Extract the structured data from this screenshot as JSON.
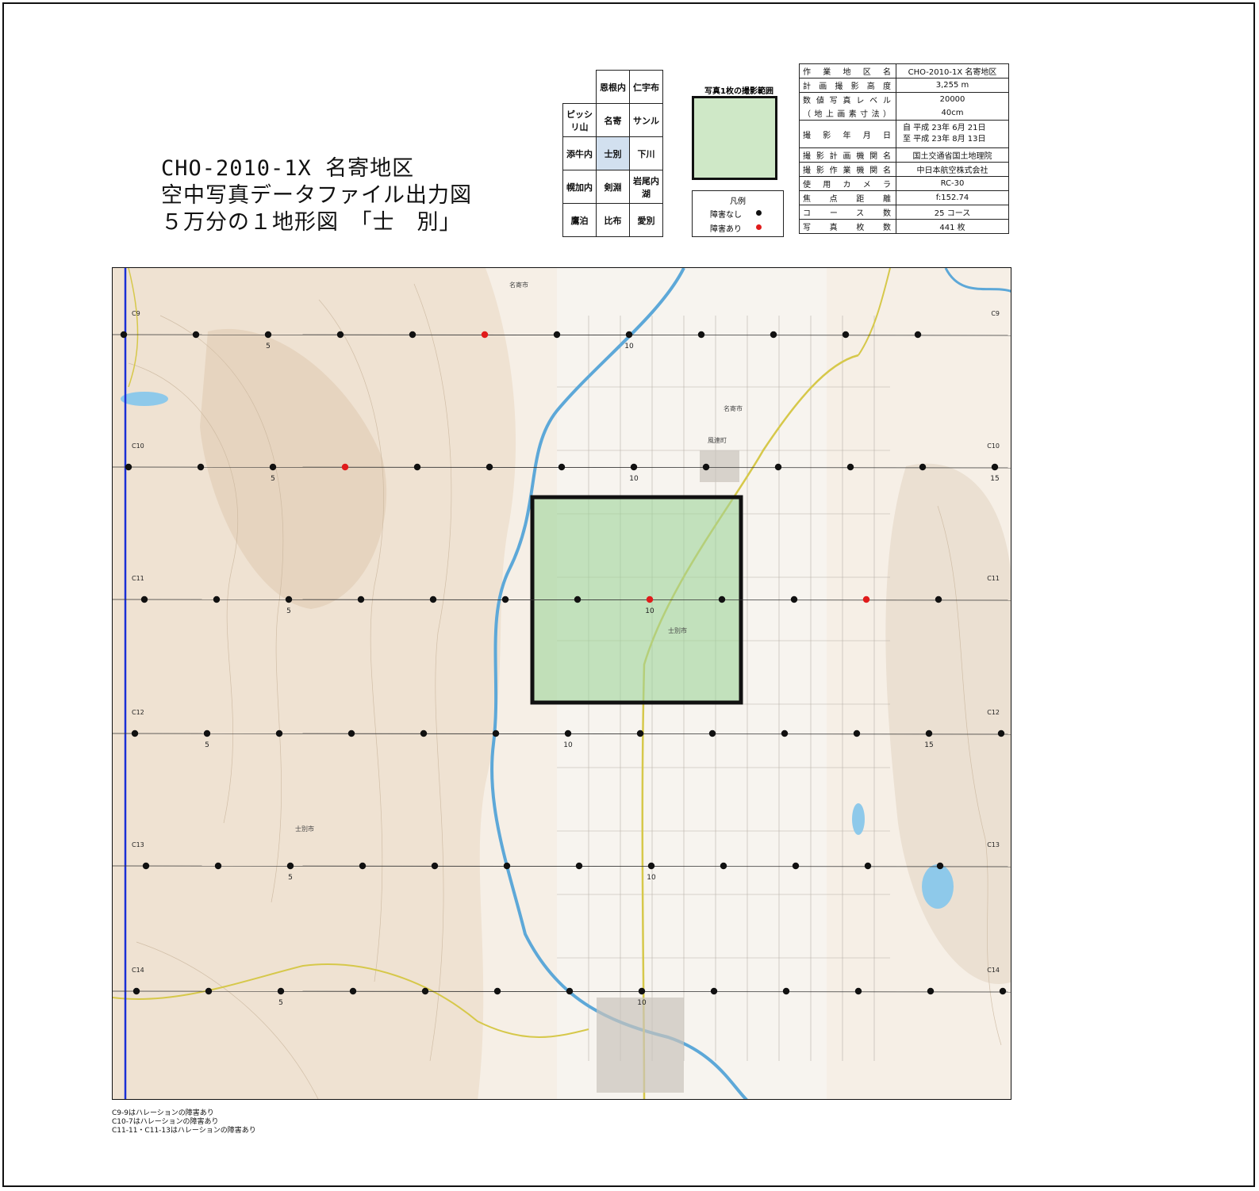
{
  "title": {
    "line1": "CHO-2010-1X 名寄地区",
    "line2": "空中写真データファイル出力図",
    "line3": "５万分の１地形図　「士　別」"
  },
  "index_map": {
    "rows": [
      [
        "",
        "恩根内",
        "仁宇布"
      ],
      [
        "ピッシリ山",
        "名寄",
        "サンル"
      ],
      [
        "添牛内",
        "士別",
        "下川"
      ],
      [
        "幌加内",
        "剣淵",
        "岩尾内湖"
      ],
      [
        "鷹泊",
        "比布",
        "愛別"
      ]
    ],
    "selected": "士別"
  },
  "photo_coverage": {
    "label": "写真1枚の撮影範囲",
    "color": "#cfe8c7"
  },
  "legend": {
    "title": "凡例",
    "no_obstacle": "障害なし",
    "obstacle": "障害あり",
    "no_obstacle_color": "#111111",
    "obstacle_color": "#e01b1b"
  },
  "info": [
    {
      "label": "作業地区名",
      "value": "CHO-2010-1X 名寄地区"
    },
    {
      "label": "計画撮影高度",
      "value": "3,255 m"
    },
    {
      "label": "数値写真レベル",
      "value": "20000"
    },
    {
      "label": "（地上画素寸法）",
      "value": "40cm"
    },
    {
      "label": "撮影年月日",
      "value": "自 平成 23年 6月 21日",
      "value2": "至 平成 23年 8月 13日"
    },
    {
      "label": "撮影計画機関名",
      "value": "国土交通省国土地理院"
    },
    {
      "label": "撮影作業機関名",
      "value": "中日本航空株式会社"
    },
    {
      "label": "使用カメラ",
      "value": "RC-30"
    },
    {
      "label": "焦点距離",
      "value": "f:152.74"
    },
    {
      "label": "コース数",
      "value": "25 コース"
    },
    {
      "label": "写真枚数",
      "value": "441 枚"
    }
  ],
  "map": {
    "courses": [
      {
        "name": "C9",
        "markers": [
          "5",
          "10"
        ],
        "points": 12,
        "obstacles": [
          6
        ]
      },
      {
        "name": "C10",
        "markers": [
          "5",
          "10",
          "15"
        ],
        "points": 13,
        "obstacles": [
          4
        ]
      },
      {
        "name": "C11",
        "markers": [
          "5",
          "10"
        ],
        "points": 13,
        "obstacles": [
          8,
          11
        ]
      },
      {
        "name": "C12",
        "markers": [
          "5",
          "10",
          "15"
        ],
        "points": 13,
        "obstacles": []
      },
      {
        "name": "C13",
        "markers": [
          "5",
          "10"
        ],
        "points": 13,
        "obstacles": []
      },
      {
        "name": "C14",
        "markers": [
          "5",
          "10"
        ],
        "points": 13,
        "obstacles": []
      }
    ],
    "place_labels": [
      "名寄市",
      "風連町",
      "士別市",
      "士別市",
      "名寄市"
    ]
  },
  "notes": [
    "C9-9はハレーションの障害あり",
    "C10-7はハレーションの障害あり",
    "C11-11・C11-13はハレーションの障害あり"
  ]
}
